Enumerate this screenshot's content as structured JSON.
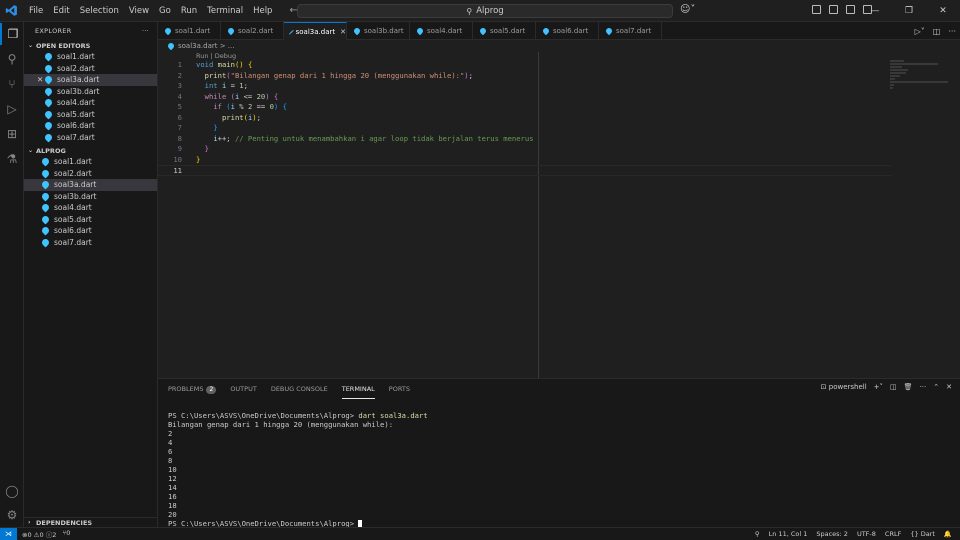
{
  "titlebar": {
    "menu": [
      "File",
      "Edit",
      "Selection",
      "View",
      "Go",
      "Run",
      "Terminal",
      "Help"
    ],
    "command_center": "Alprog"
  },
  "sidebar": {
    "header": "EXPLORER",
    "open_editors_label": "OPEN EDITORS",
    "open_editors": [
      "soal1.dart",
      "soal2.dart",
      "soal3a.dart",
      "soal3b.dart",
      "soal4.dart",
      "soal5.dart",
      "soal6.dart",
      "soal7.dart"
    ],
    "folder_label": "ALPROG",
    "folder_files": [
      "soal1.dart",
      "soal2.dart",
      "soal3a.dart",
      "soal3b.dart",
      "soal4.dart",
      "soal5.dart",
      "soal6.dart",
      "soal7.dart"
    ],
    "dependencies_label": "DEPENDENCIES"
  },
  "tabs": [
    "soal1.dart",
    "soal2.dart",
    "soal3a.dart",
    "soal3b.dart",
    "soal4.dart",
    "soal5.dart",
    "soal6.dart",
    "soal7.dart"
  ],
  "active_tab": "soal3a.dart",
  "breadcrumb": "soal3a.dart > ...",
  "codelens": "Run | Debug",
  "code": {
    "line_numbers": [
      "1",
      "2",
      "3",
      "4",
      "5",
      "6",
      "7",
      "8",
      "9",
      "10",
      "11"
    ],
    "lines": [
      "void main() {",
      "  print(\"Bilangan genap dari 1 hingga 20 (menggunakan while):\");",
      "  int i = 1;",
      "  while (i <= 20) {",
      "    if (i % 2 == 0) {",
      "      print(i);",
      "    }",
      "    i++; // Penting untuk menambahkan i agar loop tidak berjalan terus menerus",
      "  }",
      "}",
      ""
    ]
  },
  "panel": {
    "tabs": [
      "PROBLEMS",
      "OUTPUT",
      "DEBUG CONSOLE",
      "TERMINAL",
      "PORTS"
    ],
    "problems_count": "2",
    "active_tab": "TERMINAL",
    "shell": "powershell",
    "terminal_prompt": "PS C:\\Users\\ASVS\\OneDrive\\Documents\\Alprog> ",
    "terminal_command": "dart soal3a.dart",
    "terminal_output": [
      "Bilangan genap dari 1 hingga 20 (menggunakan while):",
      "2",
      "4",
      "6",
      "8",
      "10",
      "12",
      "14",
      "16",
      "18",
      "20"
    ]
  },
  "statusbar": {
    "errors": "0",
    "warnings": "0",
    "info": "2",
    "ports": "0",
    "position": "Ln 11, Col 1",
    "spaces": "Spaces: 2",
    "encoding": "UTF-8",
    "eol": "CRLF",
    "language": "Dart"
  }
}
